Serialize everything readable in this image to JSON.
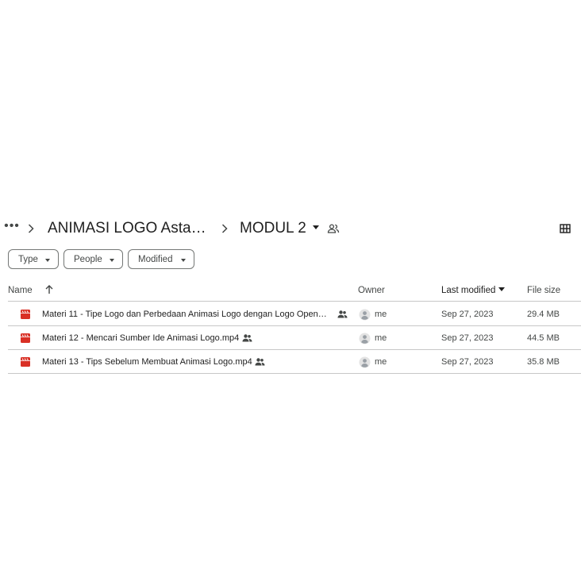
{
  "breadcrumb": {
    "more_label": "•••",
    "crumb1": "ANIMASI LOGO Asta D...",
    "crumb2": "MODUL 2"
  },
  "filters": {
    "type": "Type",
    "people": "People",
    "modified": "Modified"
  },
  "table": {
    "headers": {
      "name": "Name",
      "owner": "Owner",
      "last_modified": "Last modified",
      "file_size": "File size"
    },
    "rows": [
      {
        "name": "Materi 11 - Tipe Logo dan Perbedaan Animasi Logo dengan Logo Opener.mp4",
        "owner": "me",
        "modified": "Sep 27, 2023",
        "size": "29.4 MB"
      },
      {
        "name": "Materi 12 - Mencari Sumber Ide Animasi Logo.mp4",
        "owner": "me",
        "modified": "Sep 27, 2023",
        "size": "44.5 MB"
      },
      {
        "name": "Materi 13 - Tips Sebelum Membuat Animasi Logo.mp4",
        "owner": "me",
        "modified": "Sep 27, 2023",
        "size": "35.8 MB"
      }
    ]
  },
  "colors": {
    "video_icon": "#d93025",
    "text": "#1f1f1f",
    "muted": "#444746",
    "divider": "#c7c7c7"
  },
  "icons": {
    "breadcrumb_more": "more-horiz-icon",
    "breadcrumb_sep": "chevron-right-icon",
    "folder_shared": "people-outline-icon",
    "view_toggle": "grid-view-icon",
    "sort": "arrow-up-icon",
    "file_type": "video-file-icon",
    "shared": "people-icon",
    "owner_avatar": "account-circle-icon"
  }
}
